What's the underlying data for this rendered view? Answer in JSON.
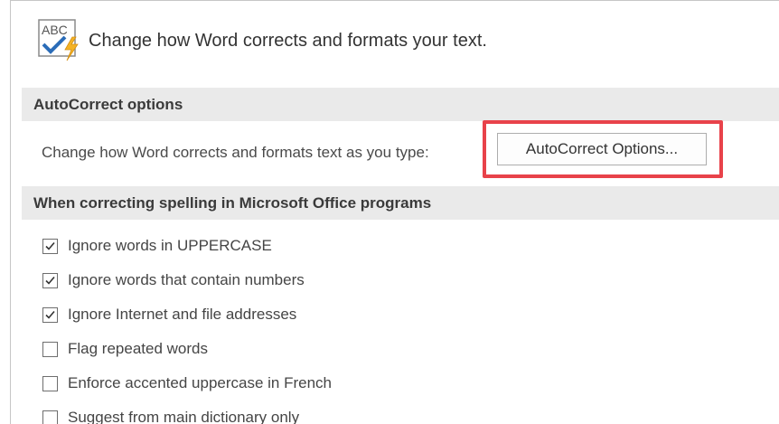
{
  "header": {
    "icon": "abc-autocorrect-icon",
    "title": "Change how Word corrects and formats your text."
  },
  "autocorrect": {
    "section_title": "AutoCorrect options",
    "description": "Change how Word corrects and formats text as you type:",
    "button_label": "AutoCorrect Options...",
    "highlight_color": "#e8424a"
  },
  "spelling": {
    "section_title": "When correcting spelling in Microsoft Office programs",
    "options": [
      {
        "label": "Ignore words in UPPERCASE",
        "checked": true
      },
      {
        "label": "Ignore words that contain numbers",
        "checked": true
      },
      {
        "label": "Ignore Internet and file addresses",
        "checked": true
      },
      {
        "label": "Flag repeated words",
        "checked": false
      },
      {
        "label": "Enforce accented uppercase in French",
        "checked": false
      },
      {
        "label": "Suggest from main dictionary only",
        "checked": false
      }
    ]
  }
}
